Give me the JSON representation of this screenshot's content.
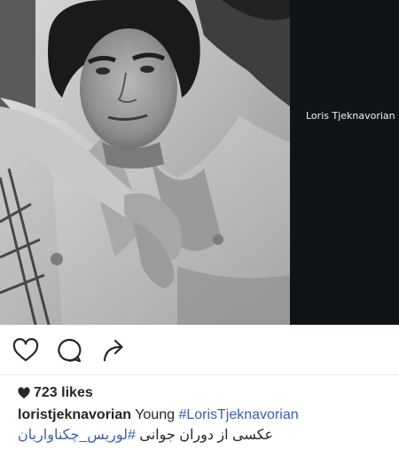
{
  "post": {
    "image_caption": "Loris Tjeknavorian",
    "likes_count": "723",
    "likes_label": "likes",
    "username": "loristjeknavorian",
    "caption_text": "Young",
    "hashtag_1": "#LorisTjeknavorian",
    "hashtag_2": "#لوریس_چکناواریان",
    "caption_persian": "عکسی از دوران جوانی"
  },
  "icons": {
    "like": "heart-outline-icon",
    "comment": "comment-bubble-icon",
    "share": "share-arrow-icon",
    "likes_heart": "heart-filled-icon"
  },
  "colors": {
    "hashtag": "#3b5fa8",
    "cover_background": "#101318",
    "text": "#262626"
  }
}
